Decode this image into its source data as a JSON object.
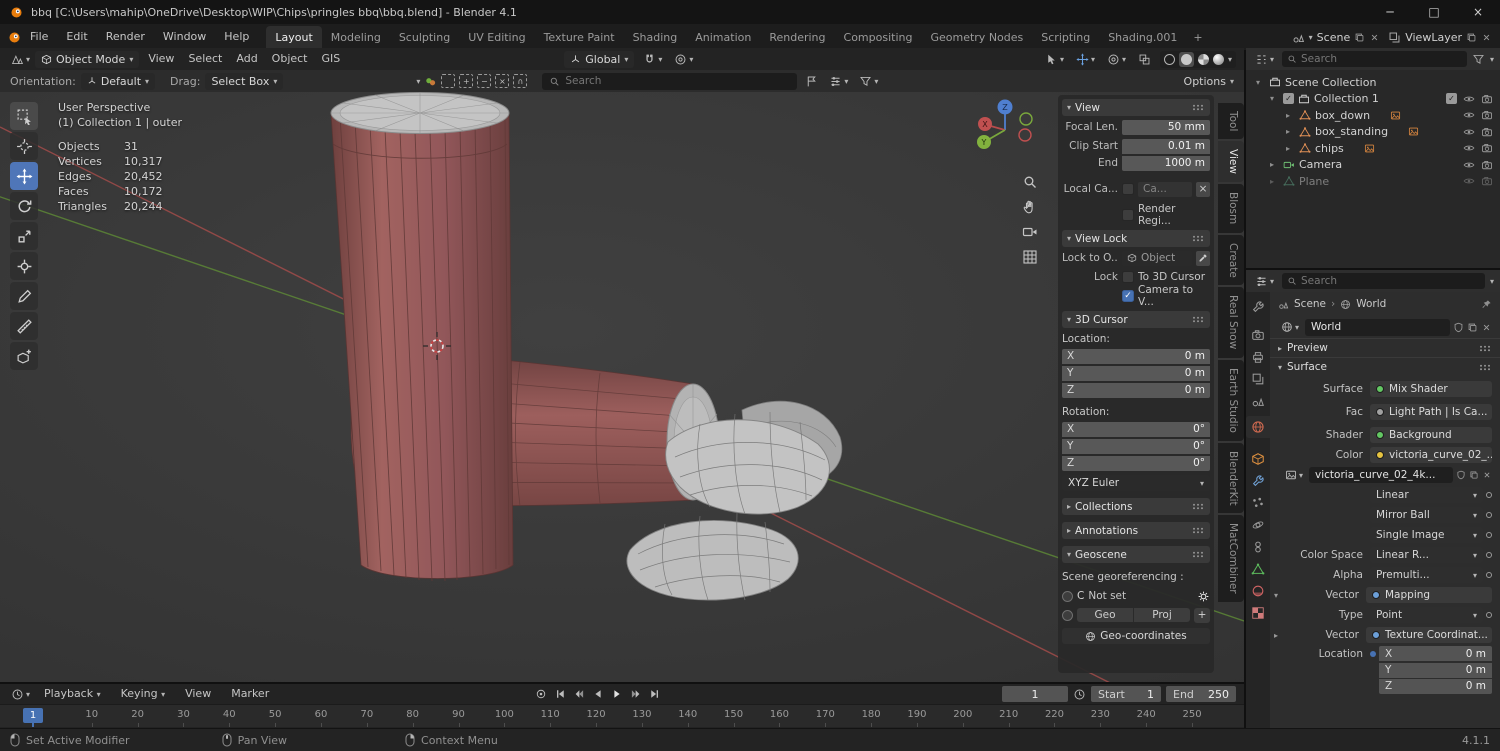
{
  "window": {
    "title": "bbq [C:\\Users\\mahip\\OneDrive\\Desktop\\WIP\\Chips\\pringles bbq\\bbq.blend] - Blender 4.1"
  },
  "topbar": {
    "menus": [
      "File",
      "Edit",
      "Render",
      "Window",
      "Help"
    ],
    "workspaces": [
      "Layout",
      "Modeling",
      "Sculpting",
      "UV Editing",
      "Texture Paint",
      "Shading",
      "Animation",
      "Rendering",
      "Compositing",
      "Geometry Nodes",
      "Scripting",
      "Shading.001"
    ],
    "add_tab": "+",
    "scene_name": "Scene",
    "viewlayer_name": "ViewLayer"
  },
  "viewport": {
    "header": {
      "mode": "Object Mode",
      "menus": [
        "View",
        "Select",
        "Add",
        "Object",
        "GIS"
      ],
      "orientation": "Global"
    },
    "tools": {
      "orientation_label": "Orientation:",
      "orientation_value": "Default",
      "drag_label": "Drag:",
      "drag_value": "Select Box",
      "search_placeholder": "Search",
      "options": "Options"
    },
    "overlay": {
      "view_name": "User Perspective",
      "context": "(1) Collection 1 | outer",
      "stats": [
        {
          "label": "Objects",
          "value": "31"
        },
        {
          "label": "Vertices",
          "value": "10,317"
        },
        {
          "label": "Edges",
          "value": "20,452"
        },
        {
          "label": "Faces",
          "value": "10,172"
        },
        {
          "label": "Triangles",
          "value": "20,244"
        }
      ]
    },
    "gizmo": {
      "x": "X",
      "y": "Y",
      "z": "Z"
    },
    "sidebar_tabs": [
      "Tool",
      "View",
      "Blosm",
      "Create",
      "Real Snow",
      "Earth Studio",
      "BlenderKit",
      "MatCombiner"
    ]
  },
  "npanel": {
    "view_title": "View",
    "focal_label": "Focal Len.",
    "focal_value": "50 mm",
    "clip_start_label": "Clip Start",
    "clip_start_value": "0.01 m",
    "clip_end_label": "End",
    "clip_end_value": "1000 m",
    "local_cam_label": "Local Ca...",
    "local_cam_value": "Ca...",
    "render_region_label": "Render Regi...",
    "view_lock_title": "View Lock",
    "lock_obj_label": "Lock to O...",
    "lock_obj_value": "Object",
    "lock_label": "Lock",
    "to_cursor_label": "To 3D Cursor",
    "cam_to_view_label": "Camera to V...",
    "cursor_title": "3D Cursor",
    "location_label": "Location:",
    "rotation_label": "Rotation:",
    "loc": [
      {
        "axis": "X",
        "value": "0 m"
      },
      {
        "axis": "Y",
        "value": "0 m"
      },
      {
        "axis": "Z",
        "value": "0 m"
      }
    ],
    "rot": [
      {
        "axis": "X",
        "value": "0°"
      },
      {
        "axis": "Y",
        "value": "0°"
      },
      {
        "axis": "Z",
        "value": "0°"
      }
    ],
    "rotation_mode": "XYZ Euler",
    "collections_title": "Collections",
    "annotations_title": "Annotations",
    "geoscene_title": "Geoscene",
    "georef_label": "Scene georeferencing :",
    "crs_prefix": "C",
    "crs_value": "Not set",
    "geo_btn": "Geo",
    "proj_btn": "Proj",
    "add_btn": "+",
    "geocoords_btn": "Geo-coordinates"
  },
  "outliner": {
    "search_placeholder": "Search",
    "root": "Scene Collection",
    "items": [
      {
        "label": "Collection 1"
      },
      {
        "label": "box_down"
      },
      {
        "label": "box_standing"
      },
      {
        "label": "chips"
      },
      {
        "label": "Camera"
      },
      {
        "label": "Plane"
      }
    ]
  },
  "properties": {
    "search_placeholder": "Search",
    "breadcrumb_scene": "Scene",
    "breadcrumb_world": "World",
    "world_name": "World",
    "preview_title": "Preview",
    "surface_title": "Surface",
    "surface_label": "Surface",
    "surface_value": "Mix Shader",
    "fac_label": "Fac",
    "fac_value": "Light Path | Is Ca...",
    "shader_label": "Shader",
    "shader_value": "Background",
    "color_label": "Color",
    "color_value": "victoria_curve_02_...",
    "image_name": "victoria_curve_02_4k...",
    "interpolation_value": "Linear",
    "projection_value": "Mirror Ball",
    "source_value": "Single Image",
    "colorspace_label": "Color Space",
    "colorspace_value": "Linear R...",
    "alpha_label": "Alpha",
    "alpha_value": "Premulti...",
    "vector_label": "Vector",
    "vector_value": "Mapping",
    "type_label": "Type",
    "type_value": "Point",
    "vector2_label": "Vector",
    "vector2_value": "Texture Coordinat...",
    "location_label": "Location",
    "loc": [
      {
        "axis": "X",
        "value": "0 m"
      },
      {
        "axis": "Y",
        "value": "0 m"
      },
      {
        "axis": "Z",
        "value": "0 m"
      }
    ]
  },
  "timeline": {
    "menus": [
      "Playback",
      "Keying",
      "View",
      "Marker"
    ],
    "current_frame": "1",
    "start_label": "Start",
    "start_value": "1",
    "end_label": "End",
    "end_value": "250",
    "ruler": [
      "1",
      "10",
      "20",
      "30",
      "40",
      "50",
      "60",
      "70",
      "80",
      "90",
      "100",
      "110",
      "120",
      "130",
      "140",
      "150",
      "160",
      "170",
      "180",
      "190",
      "200",
      "210",
      "220",
      "230",
      "240",
      "250"
    ]
  },
  "statusbar": {
    "item1": "Set Active Modifier",
    "item2": "Pan View",
    "item3": "Context Menu",
    "version": "4.1.1"
  },
  "colors": {
    "accent": "#4772b3",
    "can_red": "#9d5f5d",
    "axis_x": "#a84d4b",
    "axis_y": "#5f8c36"
  }
}
